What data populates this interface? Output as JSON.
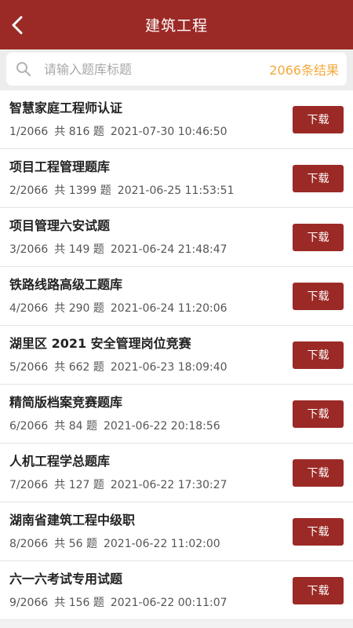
{
  "header": {
    "title": "建筑工程"
  },
  "search": {
    "placeholder": "请输入题库标题",
    "result_count": "2066条结果"
  },
  "download_label": "下载",
  "items": [
    {
      "title": "智慧家庭工程师认证",
      "index": "1/2066",
      "count": "共 816 题",
      "date": "2021-07-30 10:46:50"
    },
    {
      "title": "项目工程管理题库",
      "index": "2/2066",
      "count": "共 1399 题",
      "date": "2021-06-25 11:53:51"
    },
    {
      "title": "项目管理六安试题",
      "index": "3/2066",
      "count": "共 149 题",
      "date": "2021-06-24 21:48:47"
    },
    {
      "title": "铁路线路高级工题库",
      "index": "4/2066",
      "count": "共 290 题",
      "date": "2021-06-24 11:20:06"
    },
    {
      "title": "湖里区 2021 安全管理岗位竞赛",
      "index": "5/2066",
      "count": "共 662 题",
      "date": "2021-06-23 18:09:40"
    },
    {
      "title": "精简版档案竞赛题库",
      "index": "6/2066",
      "count": "共 84 题",
      "date": "2021-06-22 20:18:56"
    },
    {
      "title": "人机工程学总题库",
      "index": "7/2066",
      "count": "共 127 题",
      "date": "2021-06-22 17:30:27"
    },
    {
      "title": "湖南省建筑工程中级职",
      "index": "8/2066",
      "count": "共 56 题",
      "date": "2021-06-22 11:02:00"
    },
    {
      "title": "六一六考试专用试题",
      "index": "9/2066",
      "count": "共 156 题",
      "date": "2021-06-22 00:11:07"
    }
  ]
}
